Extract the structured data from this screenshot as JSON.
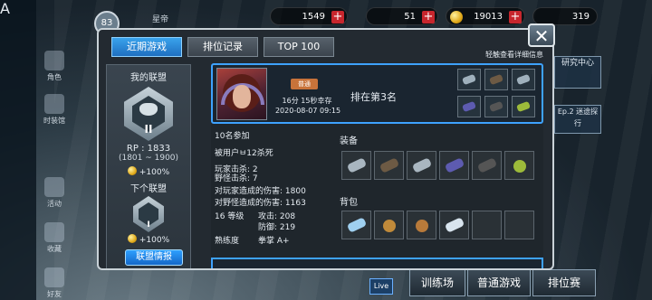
{
  "top": {
    "level": "83",
    "rank_label": "星帝",
    "stat1": "1549",
    "stat2": "51",
    "gold": "19013",
    "energy": "319"
  },
  "sidebar": {
    "items": [
      {
        "label": "角色",
        "icon": "character-icon"
      },
      {
        "label": "时装馆",
        "icon": "wardrobe-icon"
      },
      {
        "label": "活动",
        "icon": "event-icon"
      },
      {
        "label": "收藏",
        "icon": "collection-icon"
      },
      {
        "label": "好友",
        "icon": "friends-icon"
      }
    ]
  },
  "right_panel": {
    "card1": "研究中心",
    "card2": "Ep.2 迷途探行",
    "buttons": [
      "训练场",
      "普通游戏",
      "排位赛"
    ],
    "live": "Live"
  },
  "modal": {
    "tabs": [
      "近期游戏",
      "排位记录",
      "TOP 100"
    ],
    "hint": "轻触查看详细信息",
    "close_label": "✕",
    "league": {
      "title": "我的联盟",
      "tier": "II",
      "rp": "RP : 1833",
      "rp_range": "(1801 ~ 1900)",
      "bonus": "+100%",
      "next_title": "下个联盟",
      "next_tier": "I",
      "next_bonus": "+100%",
      "info_button": "联盟情报"
    },
    "match": {
      "mode": "普通",
      "survive_time": "16分 15秒幸存",
      "date": "2020-08-07 09:15",
      "placement": "排在第3名",
      "participants": "10名参加",
      "killed_by": "被用户ㅂ12杀死",
      "player_kills": "玩家击杀: 2",
      "monster_kills": "野怪击杀: 7",
      "player_damage": "对玩家造成的伤害: 1800",
      "monster_damage": "对野怪造成的伤害: 1163",
      "level": "16 等级",
      "attack": "攻击: 208",
      "defense": "防御: 219",
      "mastery_label": "熟练度",
      "mastery_value": "拳掌 A+",
      "equipment_title": "装备",
      "bag_title": "背包"
    }
  }
}
